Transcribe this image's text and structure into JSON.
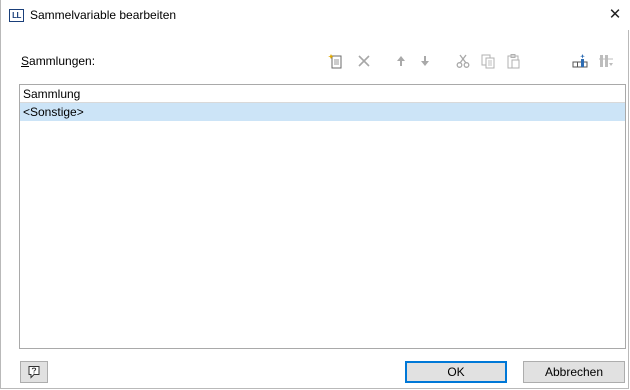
{
  "window": {
    "app_icon_text": "LL",
    "title": "Sammelvariable bearbeiten",
    "close_glyph": "✕"
  },
  "collections": {
    "label_accel": "S",
    "label_rest": "ammlungen:"
  },
  "toolbar": {
    "icons": [
      "new-item-icon",
      "delete-icon",
      "move-up-icon",
      "move-down-icon",
      "cut-icon",
      "copy-icon",
      "paste-icon",
      "insert-column-icon",
      "column-settings-icon"
    ]
  },
  "list": {
    "header": "Sammlung",
    "items": [
      "<Sonstige>"
    ],
    "selected_color": "#cce4f7"
  },
  "buttons": {
    "ok": "OK",
    "cancel": "Abbrechen"
  },
  "colors": {
    "focus_border": "#0078d7",
    "button_bg": "#e1e1e1"
  }
}
